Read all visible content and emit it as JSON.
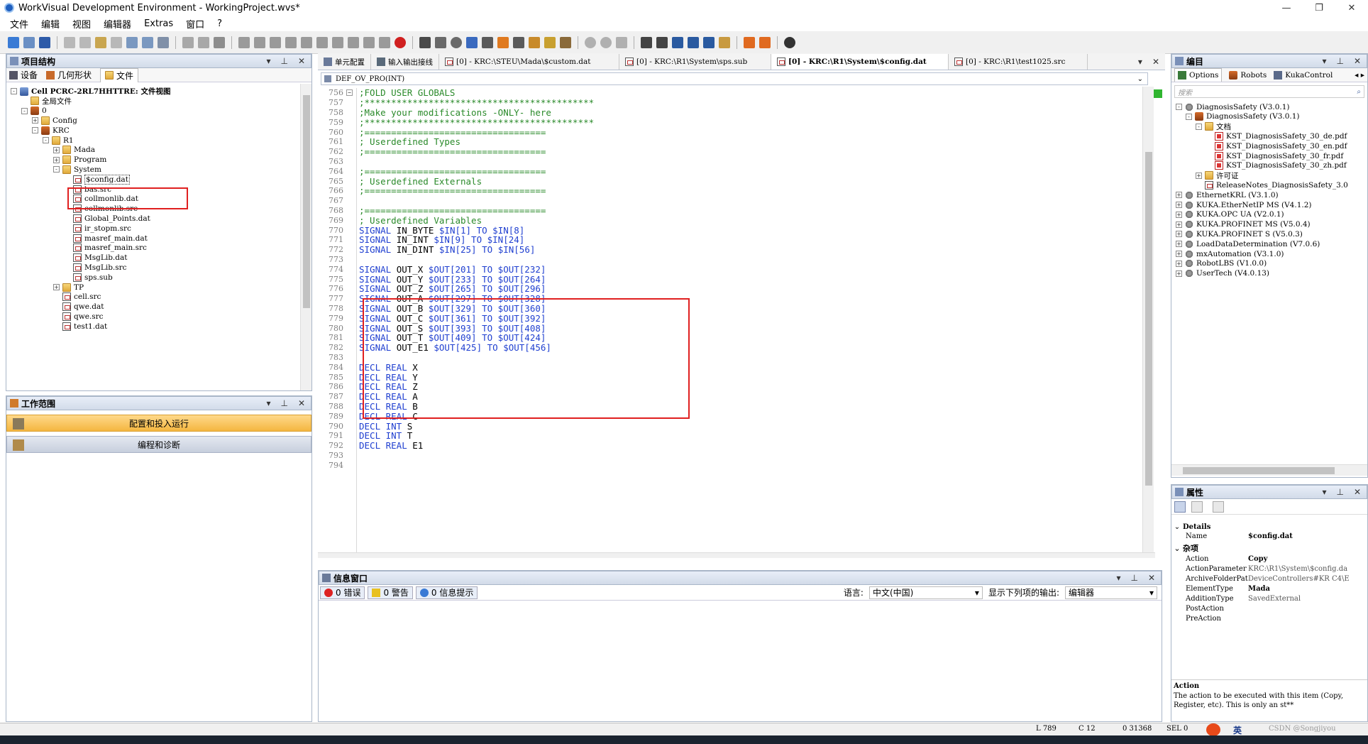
{
  "window": {
    "title": "WorkVisual Development Environment - WorkingProject.wvs*",
    "controls": [
      "—",
      "❐",
      "✕"
    ]
  },
  "menu": [
    "文件",
    "编辑",
    "视图",
    "编辑器",
    "Extras",
    "窗口",
    "?"
  ],
  "left_top": {
    "title": "项目结构",
    "tabs": [
      "设备",
      "几何形状",
      "文件"
    ],
    "tree": [
      {
        "label": "Cell PCRC-2RL7HHTTRE: 文件视图",
        "indent": 0,
        "exp": "-",
        "icon": "cell",
        "bold": true
      },
      {
        "label": "全局文件",
        "indent": 1,
        "exp": "",
        "icon": "folder"
      },
      {
        "label": "0",
        "indent": 1,
        "exp": "-",
        "icon": "robot"
      },
      {
        "label": "Config",
        "indent": 2,
        "exp": "+",
        "icon": "folder"
      },
      {
        "label": "KRC",
        "indent": 2,
        "exp": "-",
        "icon": "robot"
      },
      {
        "label": "R1",
        "indent": 3,
        "exp": "-",
        "icon": "folder"
      },
      {
        "label": "Mada",
        "indent": 4,
        "exp": "+",
        "icon": "folder"
      },
      {
        "label": "Program",
        "indent": 4,
        "exp": "+",
        "icon": "folder"
      },
      {
        "label": "System",
        "indent": 4,
        "exp": "-",
        "icon": "folder"
      },
      {
        "label": "$config.dat",
        "indent": 5,
        "exp": "",
        "icon": "file",
        "selected": true
      },
      {
        "label": "bas.src",
        "indent": 5,
        "exp": "",
        "icon": "file"
      },
      {
        "label": "collmonlib.dat",
        "indent": 5,
        "exp": "",
        "icon": "file"
      },
      {
        "label": "collmonlib.src",
        "indent": 5,
        "exp": "",
        "icon": "file"
      },
      {
        "label": "Global_Points.dat",
        "indent": 5,
        "exp": "",
        "icon": "file"
      },
      {
        "label": "ir_stopm.src",
        "indent": 5,
        "exp": "",
        "icon": "file"
      },
      {
        "label": "masref_main.dat",
        "indent": 5,
        "exp": "",
        "icon": "file"
      },
      {
        "label": "masref_main.src",
        "indent": 5,
        "exp": "",
        "icon": "file"
      },
      {
        "label": "MsgLib.dat",
        "indent": 5,
        "exp": "",
        "icon": "file"
      },
      {
        "label": "MsgLib.src",
        "indent": 5,
        "exp": "",
        "icon": "file"
      },
      {
        "label": "sps.sub",
        "indent": 5,
        "exp": "",
        "icon": "file"
      },
      {
        "label": "TP",
        "indent": 4,
        "exp": "+",
        "icon": "folder"
      },
      {
        "label": "cell.src",
        "indent": 4,
        "exp": "",
        "icon": "file"
      },
      {
        "label": "qwe.dat",
        "indent": 4,
        "exp": "",
        "icon": "file"
      },
      {
        "label": "qwe.src",
        "indent": 4,
        "exp": "",
        "icon": "file"
      },
      {
        "label": "test1.dat",
        "indent": 4,
        "exp": "",
        "icon": "file"
      }
    ]
  },
  "left_bottom": {
    "title": "工作范围",
    "buttons": [
      "配置和投入运行",
      "编程和诊断"
    ]
  },
  "editor": {
    "tabs": [
      {
        "label": "单元配置",
        "active": false
      },
      {
        "label": "输入输出接线",
        "active": false
      },
      {
        "label": "[0] - KRC:\\STEU\\Mada\\$custom.dat",
        "active": false
      },
      {
        "label": "[0] - KRC:\\R1\\System\\sps.sub",
        "active": false
      },
      {
        "label": "[0] - KRC:\\R1\\System\\$config.dat",
        "active": true
      },
      {
        "label": "[0] - KRC:\\R1\\test1025.src",
        "active": false
      }
    ],
    "scope": "DEF_OV_PRO(INT)",
    "lines": [
      {
        "n": "756",
        "fold": true,
        "parts": [
          [
            "cm",
            ";FOLD USER GLOBALS"
          ]
        ]
      },
      {
        "n": "757",
        "parts": [
          [
            "cm",
            ";*******************************************"
          ]
        ]
      },
      {
        "n": "758",
        "parts": [
          [
            "cm",
            ";Make your modifications -ONLY- here"
          ]
        ]
      },
      {
        "n": "759",
        "parts": [
          [
            "cm",
            ";*******************************************"
          ]
        ]
      },
      {
        "n": "760",
        "parts": [
          [
            "cm",
            ";=================================="
          ]
        ]
      },
      {
        "n": "761",
        "parts": [
          [
            "cm",
            "; Userdefined Types"
          ]
        ]
      },
      {
        "n": "762",
        "parts": [
          [
            "cm",
            ";=================================="
          ]
        ]
      },
      {
        "n": "763",
        "parts": []
      },
      {
        "n": "764",
        "parts": [
          [
            "cm",
            ";=================================="
          ]
        ]
      },
      {
        "n": "765",
        "parts": [
          [
            "cm",
            "; Userdefined Externals"
          ]
        ]
      },
      {
        "n": "766",
        "parts": [
          [
            "cm",
            ";=================================="
          ]
        ]
      },
      {
        "n": "767",
        "parts": []
      },
      {
        "n": "768",
        "parts": [
          [
            "cm",
            ";=================================="
          ]
        ]
      },
      {
        "n": "769",
        "parts": [
          [
            "cm",
            "; Userdefined Variables"
          ]
        ]
      },
      {
        "n": "770",
        "parts": [
          [
            "kw",
            "SIGNAL "
          ],
          [
            "ident",
            "IN_BYTE "
          ],
          [
            "kw",
            "$IN[1] TO $IN[8]"
          ]
        ]
      },
      {
        "n": "771",
        "parts": [
          [
            "kw",
            "SIGNAL "
          ],
          [
            "ident",
            "IN_INT "
          ],
          [
            "kw",
            "$IN[9] TO $IN[24]"
          ]
        ]
      },
      {
        "n": "772",
        "parts": [
          [
            "kw",
            "SIGNAL "
          ],
          [
            "ident",
            "IN_DINT "
          ],
          [
            "kw",
            "$IN[25] TO $IN[56]"
          ]
        ]
      },
      {
        "n": "773",
        "parts": []
      },
      {
        "n": "774",
        "parts": [
          [
            "kw",
            "SIGNAL "
          ],
          [
            "ident",
            "OUT_X "
          ],
          [
            "kw",
            "$OUT[201] TO $OUT[232]"
          ]
        ]
      },
      {
        "n": "775",
        "parts": [
          [
            "kw",
            "SIGNAL "
          ],
          [
            "ident",
            "OUT_Y "
          ],
          [
            "kw",
            "$OUT[233] TO $OUT[264]"
          ]
        ]
      },
      {
        "n": "776",
        "parts": [
          [
            "kw",
            "SIGNAL "
          ],
          [
            "ident",
            "OUT_Z "
          ],
          [
            "kw",
            "$OUT[265] TO $OUT[296]"
          ]
        ]
      },
      {
        "n": "777",
        "parts": [
          [
            "kw",
            "SIGNAL "
          ],
          [
            "ident",
            "OUT_A "
          ],
          [
            "kw",
            "$OUT[297] TO $OUT[328]"
          ]
        ]
      },
      {
        "n": "778",
        "parts": [
          [
            "kw",
            "SIGNAL "
          ],
          [
            "ident",
            "OUT_B "
          ],
          [
            "kw",
            "$OUT[329] TO $OUT[360]"
          ]
        ]
      },
      {
        "n": "779",
        "parts": [
          [
            "kw",
            "SIGNAL "
          ],
          [
            "ident",
            "OUT_C "
          ],
          [
            "kw",
            "$OUT[361] TO $OUT[392]"
          ]
        ]
      },
      {
        "n": "780",
        "parts": [
          [
            "kw",
            "SIGNAL "
          ],
          [
            "ident",
            "OUT_S "
          ],
          [
            "kw",
            "$OUT[393] TO $OUT[408]"
          ]
        ]
      },
      {
        "n": "781",
        "parts": [
          [
            "kw",
            "SIGNAL "
          ],
          [
            "ident",
            "OUT_T "
          ],
          [
            "kw",
            "$OUT[409] TO $OUT[424]"
          ]
        ]
      },
      {
        "n": "782",
        "parts": [
          [
            "kw",
            "SIGNAL "
          ],
          [
            "ident",
            "OUT_E1 "
          ],
          [
            "kw",
            "$OUT[425] TO $OUT[456]"
          ]
        ]
      },
      {
        "n": "783",
        "parts": []
      },
      {
        "n": "784",
        "parts": [
          [
            "kw",
            "DECL REAL "
          ],
          [
            "ident",
            "X"
          ]
        ]
      },
      {
        "n": "785",
        "parts": [
          [
            "kw",
            "DECL REAL "
          ],
          [
            "ident",
            "Y"
          ]
        ]
      },
      {
        "n": "786",
        "parts": [
          [
            "kw",
            "DECL REAL "
          ],
          [
            "ident",
            "Z"
          ]
        ]
      },
      {
        "n": "787",
        "parts": [
          [
            "kw",
            "DECL REAL "
          ],
          [
            "ident",
            "A"
          ]
        ]
      },
      {
        "n": "788",
        "parts": [
          [
            "kw",
            "DECL REAL "
          ],
          [
            "ident",
            "B"
          ]
        ]
      },
      {
        "n": "789",
        "parts": [
          [
            "kw",
            "DECL REAL "
          ],
          [
            "ident",
            "C"
          ]
        ]
      },
      {
        "n": "790",
        "parts": [
          [
            "kw",
            "DECL INT "
          ],
          [
            "ident",
            "S"
          ]
        ]
      },
      {
        "n": "791",
        "parts": [
          [
            "kw",
            "DECL INT "
          ],
          [
            "ident",
            "T"
          ]
        ]
      },
      {
        "n": "792",
        "parts": [
          [
            "kw",
            "DECL REAL "
          ],
          [
            "ident",
            "E1"
          ]
        ]
      },
      {
        "n": "793",
        "parts": []
      },
      {
        "n": "794",
        "parts": []
      }
    ]
  },
  "messages": {
    "title": "信息窗口",
    "errors": "0 错误",
    "warnings": "0 警告",
    "infos": "0 信息提示",
    "lang_label": "语言:",
    "lang_value": "中文(中国)",
    "output_label": "显示下列项的输出:",
    "output_value": "编辑器"
  },
  "catalog": {
    "title": "编目",
    "tabs": [
      "Options",
      "Robots",
      "KukaControl"
    ],
    "search_placeholder": "搜索",
    "tree": [
      {
        "label": "DiagnosisSafety (V3.0.1)",
        "indent": 0,
        "exp": "-",
        "icon": "gear"
      },
      {
        "label": "DiagnosisSafety (V3.0.1)",
        "indent": 1,
        "exp": "-",
        "icon": "robot"
      },
      {
        "label": "文档",
        "indent": 2,
        "exp": "-",
        "icon": "folder"
      },
      {
        "label": "KST_DiagnosisSafety_30_de.pdf",
        "indent": 3,
        "exp": "",
        "icon": "pdf"
      },
      {
        "label": "KST_DiagnosisSafety_30_en.pdf",
        "indent": 3,
        "exp": "",
        "icon": "pdf"
      },
      {
        "label": "KST_DiagnosisSafety_30_fr.pdf",
        "indent": 3,
        "exp": "",
        "icon": "pdf"
      },
      {
        "label": "KST_DiagnosisSafety_30_zh.pdf",
        "indent": 3,
        "exp": "",
        "icon": "pdf"
      },
      {
        "label": "许可证",
        "indent": 2,
        "exp": "+",
        "icon": "folder"
      },
      {
        "label": "ReleaseNotes_DiagnosisSafety_3.0",
        "indent": 2,
        "exp": "",
        "icon": "file"
      },
      {
        "label": "EthernetKRL (V3.1.0)",
        "indent": 0,
        "exp": "+",
        "icon": "gear"
      },
      {
        "label": "KUKA.EtherNetIP MS (V4.1.2)",
        "indent": 0,
        "exp": "+",
        "icon": "gear"
      },
      {
        "label": "KUKA.OPC UA (V2.0.1)",
        "indent": 0,
        "exp": "+",
        "icon": "gear"
      },
      {
        "label": "KUKA.PROFINET MS (V5.0.4)",
        "indent": 0,
        "exp": "+",
        "icon": "gear"
      },
      {
        "label": "KUKA.PROFINET S (V5.0.3)",
        "indent": 0,
        "exp": "+",
        "icon": "gear"
      },
      {
        "label": "LoadDataDetermination (V7.0.6)",
        "indent": 0,
        "exp": "+",
        "icon": "gear"
      },
      {
        "label": "mxAutomation (V3.1.0)",
        "indent": 0,
        "exp": "+",
        "icon": "gear"
      },
      {
        "label": "RobotLBS (V1.0.0)",
        "indent": 0,
        "exp": "+",
        "icon": "gear"
      },
      {
        "label": "UserTech (V4.0.13)",
        "indent": 0,
        "exp": "+",
        "icon": "gear"
      }
    ]
  },
  "properties": {
    "title": "属性",
    "group_details": "Details",
    "group_misc": "杂项",
    "rows": [
      {
        "k": "Name",
        "v": "$config.dat",
        "group": "details",
        "bold": true
      },
      {
        "k": "Action",
        "v": "Copy",
        "group": "misc",
        "bold": true
      },
      {
        "k": "ActionParameter",
        "v": "KRC:\\R1\\System\\$config.da",
        "group": "misc"
      },
      {
        "k": "ArchiveFolderPat",
        "v": "DeviceControllers#KR C4\\E",
        "group": "misc"
      },
      {
        "k": "ElementType",
        "v": "Mada",
        "group": "misc",
        "bold": true
      },
      {
        "k": "AdditionType",
        "v": "SavedExternal",
        "group": "misc"
      },
      {
        "k": "PostAction",
        "v": "",
        "group": "misc"
      },
      {
        "k": "PreAction",
        "v": "",
        "group": "misc"
      }
    ],
    "desc_title": "Action",
    "desc_text": "The action to be executed with this item (Copy, Register, etc). This is only an st**"
  },
  "status": {
    "line": "L 789",
    "col": "C 12",
    "pos": "0 31368",
    "sel": "SEL 0"
  },
  "tray": {
    "ime": "英",
    "watermark": "CSDN @Songjiyou"
  }
}
